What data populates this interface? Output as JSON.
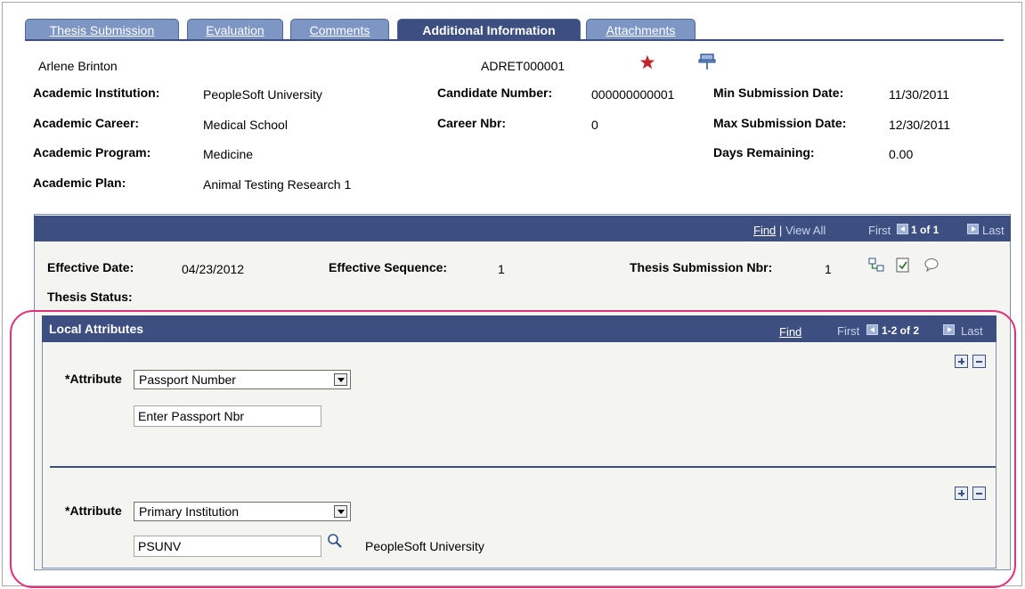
{
  "tabs": [
    {
      "label": "Thesis Submission",
      "active": false
    },
    {
      "label": "Evaluation",
      "active": false
    },
    {
      "label": "Comments",
      "active": false
    },
    {
      "label": "Additional Information",
      "active": true
    },
    {
      "label": "Attachments",
      "active": false
    }
  ],
  "header": {
    "person_name": "Arlene Brinton",
    "record_id": "ADRET000001",
    "fields": {
      "academic_institution": {
        "label": "Academic Institution:",
        "value": "PeopleSoft University"
      },
      "academic_career": {
        "label": "Academic Career:",
        "value": "Medical School"
      },
      "academic_program": {
        "label": "Academic Program:",
        "value": "Medicine"
      },
      "academic_plan": {
        "label": "Academic Plan:",
        "value": "Animal Testing Research 1"
      },
      "candidate_number": {
        "label": "Candidate Number:",
        "value": "000000000001"
      },
      "career_nbr": {
        "label": "Career Nbr:",
        "value": "0"
      },
      "min_submission_date": {
        "label": "Min Submission Date:",
        "value": "11/30/2011"
      },
      "max_submission_date": {
        "label": "Max Submission Date:",
        "value": "12/30/2011"
      },
      "days_remaining": {
        "label": "Days Remaining:",
        "value": "0.00"
      }
    }
  },
  "grid": {
    "nav": {
      "find": "Find",
      "sep": "|",
      "view_all": "View All",
      "first": "First",
      "count": "1 of 1",
      "last": "Last"
    },
    "effective_date": {
      "label": "Effective Date:",
      "value": "04/23/2012"
    },
    "effective_sequence": {
      "label": "Effective Sequence:",
      "value": "1"
    },
    "thesis_submission_nbr": {
      "label": "Thesis Submission Nbr:",
      "value": "1"
    },
    "thesis_status": {
      "label": "Thesis Status:",
      "value": ""
    }
  },
  "local_attributes": {
    "title": "Local Attributes",
    "nav": {
      "find": "Find",
      "first": "First",
      "count": "1-2 of 2",
      "last": "Last"
    },
    "rows": [
      {
        "label": "*Attribute",
        "selected": "Passport Number",
        "input_value": "Enter Passport Nbr",
        "description": ""
      },
      {
        "label": "*Attribute",
        "selected": "Primary Institution",
        "input_value": "PSUNV",
        "description": "PeopleSoft University"
      }
    ]
  },
  "colors": {
    "header_bar": "#3d4f80",
    "tab": "#7d96c4",
    "highlight": "#e0317a",
    "star": "#c0262d"
  }
}
